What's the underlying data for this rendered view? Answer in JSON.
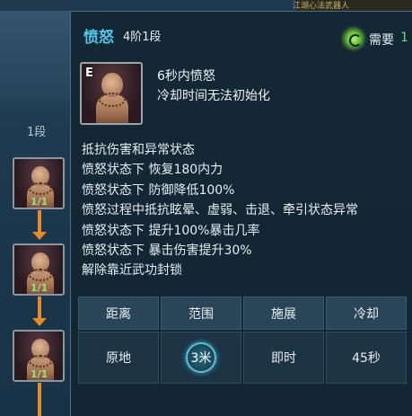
{
  "background": {
    "top_text": "江湖心法武器人",
    "stage_label": "1段",
    "nodes": [
      {
        "count": "1/1"
      },
      {
        "count": "1/1"
      },
      {
        "count": "1/1"
      }
    ]
  },
  "tooltip": {
    "title": "愤怒",
    "stage": "4阶1段",
    "need_label": "需要",
    "need_value": "1",
    "skill_key": "E",
    "skill_name": "6秒内愤怒",
    "skill_sub": "冷却时间无法初始化",
    "effects": [
      "抵抗伤害和异常状态",
      "愤怒状态下 恢复180内力",
      "愤怒状态下 防御降低100%",
      "愤怒过程中抵抗眩晕、虚弱、击退、牵引状态异常",
      "愤怒状态下 提升100%暴击几率",
      "愤怒状态下 暴击伤害提升30%",
      "解除靠近武功封锁"
    ],
    "table": {
      "headers": [
        "距离",
        "范围",
        "施展",
        "冷却"
      ],
      "values": [
        "原地",
        "3米",
        "即时",
        "45秒"
      ]
    }
  },
  "colors": {
    "title": "#52c6e8",
    "need_value": "#5ee07a",
    "arrow": "#e88a2a",
    "node_count": "#9de07a"
  }
}
